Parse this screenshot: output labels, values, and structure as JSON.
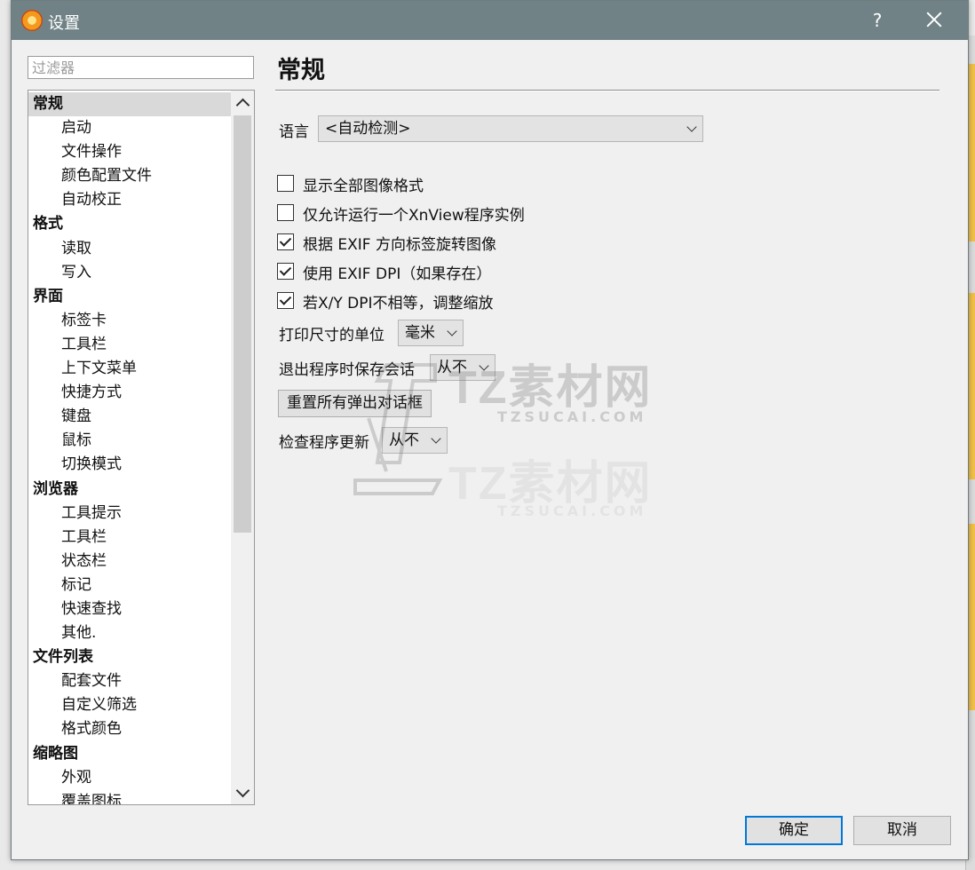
{
  "window": {
    "title": "设置",
    "help_glyph": "?"
  },
  "filter": {
    "placeholder": "过滤器",
    "value": ""
  },
  "tree": {
    "items": [
      {
        "label": "常规",
        "kind": "category",
        "selected": true
      },
      {
        "label": "启动",
        "kind": "sub"
      },
      {
        "label": "文件操作",
        "kind": "sub"
      },
      {
        "label": "颜色配置文件",
        "kind": "sub"
      },
      {
        "label": "自动校正",
        "kind": "sub"
      },
      {
        "label": "格式",
        "kind": "category"
      },
      {
        "label": "读取",
        "kind": "sub"
      },
      {
        "label": "写入",
        "kind": "sub"
      },
      {
        "label": "界面",
        "kind": "category"
      },
      {
        "label": "标签卡",
        "kind": "sub"
      },
      {
        "label": "工具栏",
        "kind": "sub"
      },
      {
        "label": "上下文菜单",
        "kind": "sub"
      },
      {
        "label": "快捷方式",
        "kind": "sub"
      },
      {
        "label": "键盘",
        "kind": "sub"
      },
      {
        "label": "鼠标",
        "kind": "sub"
      },
      {
        "label": "切换模式",
        "kind": "sub"
      },
      {
        "label": "浏览器",
        "kind": "category"
      },
      {
        "label": "工具提示",
        "kind": "sub"
      },
      {
        "label": "工具栏",
        "kind": "sub"
      },
      {
        "label": "状态栏",
        "kind": "sub"
      },
      {
        "label": "标记",
        "kind": "sub"
      },
      {
        "label": "快速查找",
        "kind": "sub"
      },
      {
        "label": "其他.",
        "kind": "sub"
      },
      {
        "label": "文件列表",
        "kind": "category"
      },
      {
        "label": "配套文件",
        "kind": "sub"
      },
      {
        "label": "自定义筛选",
        "kind": "sub"
      },
      {
        "label": "格式颜色",
        "kind": "sub"
      },
      {
        "label": "缩略图",
        "kind": "category"
      },
      {
        "label": "外观",
        "kind": "sub"
      },
      {
        "label": "覆盖图标",
        "kind": "sub"
      }
    ]
  },
  "panel": {
    "title": "常规",
    "language": {
      "label": "语言",
      "value": "<自动检测>"
    },
    "checkboxes": {
      "show_all_formats": {
        "label": "显示全部图像格式",
        "checked": false
      },
      "single_instance": {
        "label": "仅允许运行一个XnView程序实例",
        "checked": false
      },
      "exif_rotate": {
        "label": "根据 EXIF 方向标签旋转图像",
        "checked": true
      },
      "exif_dpi": {
        "label": "使用 EXIF DPI（如果存在）",
        "checked": true
      },
      "xy_dpi": {
        "label": "若X/Y DPI不相等，调整缩放",
        "checked": true
      }
    },
    "print_unit": {
      "label": "打印尺寸的单位",
      "value": "毫米"
    },
    "save_session": {
      "label": "退出程序时保存会话",
      "value": "从不"
    },
    "reset_dialogs": {
      "label": "重置所有弹出对话框"
    },
    "check_updates": {
      "label": "检查程序更新",
      "value": "从不"
    }
  },
  "watermark": {
    "brand": "TZ素材网",
    "url": "TZSUCAI.COM"
  },
  "footer": {
    "ok_label": "确定",
    "cancel_label": "取消"
  }
}
